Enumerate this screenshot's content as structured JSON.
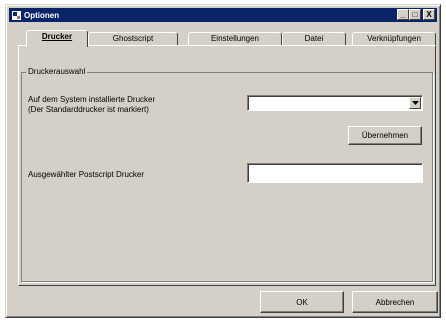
{
  "window": {
    "title": "Optionen",
    "minimize_label": "_",
    "maximize_label": "□",
    "close_label": "X"
  },
  "tabs": [
    {
      "label": "Drucker",
      "active": true
    },
    {
      "label": "Ghostscript",
      "active": false
    },
    {
      "label": "Einstellungen",
      "active": false
    },
    {
      "label": "Datei",
      "active": false
    },
    {
      "label": "Verknüpfungen",
      "active": false
    }
  ],
  "printer_group": {
    "title": "Druckerauswahl",
    "installed_label_line1": "Auf dem System installierte Drucker",
    "installed_label_line2": "(Der Standarddrucker ist markiert)",
    "installed_value": "",
    "apply_label": "Übernehmen",
    "postscript_label": "Ausgewählter Postscript Drucker",
    "postscript_value": ""
  },
  "footer": {
    "ok_label": "OK",
    "cancel_label": "Abbrechen"
  },
  "colors": {
    "titlebar": "#0a246a",
    "face": "#d4d0c8"
  }
}
